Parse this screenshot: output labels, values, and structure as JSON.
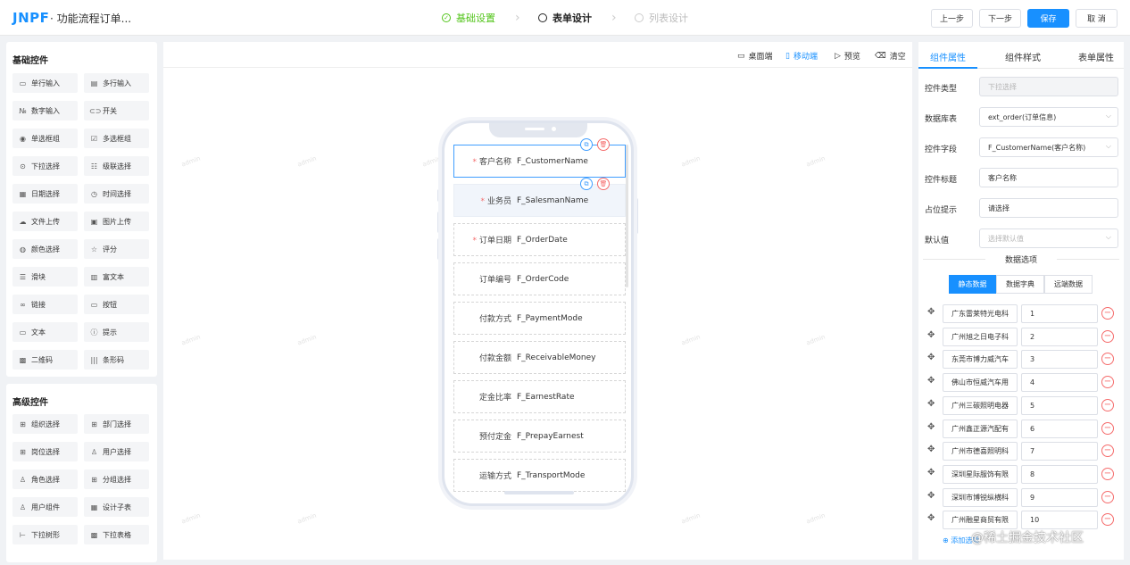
{
  "header": {
    "logo": "JNPF",
    "app_title": "· 功能流程订单...",
    "steps": [
      {
        "label": "基础设置",
        "state": "done"
      },
      {
        "label": "表单设计",
        "state": "active"
      },
      {
        "label": "列表设计",
        "state": "pending"
      }
    ],
    "buttons": {
      "prev": "上一步",
      "next": "下一步",
      "save": "保存",
      "cancel": "取 消"
    }
  },
  "left": {
    "basic_title": "基础控件",
    "basic": [
      {
        "label": "单行输入",
        "icon": "▭"
      },
      {
        "label": "多行输入",
        "icon": "▤"
      },
      {
        "label": "数字输入",
        "icon": "№"
      },
      {
        "label": "开关",
        "icon": "⊂⊃"
      },
      {
        "label": "单选框组",
        "icon": "◉"
      },
      {
        "label": "多选框组",
        "icon": "☑"
      },
      {
        "label": "下拉选择",
        "icon": "⊙"
      },
      {
        "label": "级联选择",
        "icon": "☷"
      },
      {
        "label": "日期选择",
        "icon": "▦"
      },
      {
        "label": "时间选择",
        "icon": "◷"
      },
      {
        "label": "文件上传",
        "icon": "☁"
      },
      {
        "label": "图片上传",
        "icon": "▣"
      },
      {
        "label": "颜色选择",
        "icon": "◍"
      },
      {
        "label": "评分",
        "icon": "☆"
      },
      {
        "label": "滑块",
        "icon": "☰"
      },
      {
        "label": "富文本",
        "icon": "▥"
      },
      {
        "label": "链接",
        "icon": "∞"
      },
      {
        "label": "按钮",
        "icon": "▭"
      },
      {
        "label": "文本",
        "icon": "▭"
      },
      {
        "label": "提示",
        "icon": "ⓘ"
      },
      {
        "label": "二维码",
        "icon": "▩"
      },
      {
        "label": "条形码",
        "icon": "|||"
      }
    ],
    "advanced_title": "高级控件",
    "advanced": [
      {
        "label": "组织选择",
        "icon": "⊞"
      },
      {
        "label": "部门选择",
        "icon": "⊞"
      },
      {
        "label": "岗位选择",
        "icon": "⊞"
      },
      {
        "label": "用户选择",
        "icon": "♙"
      },
      {
        "label": "角色选择",
        "icon": "♙"
      },
      {
        "label": "分组选择",
        "icon": "⊞"
      },
      {
        "label": "用户组件",
        "icon": "♙"
      },
      {
        "label": "设计子表",
        "icon": "▦"
      },
      {
        "label": "下拉树形",
        "icon": "⊢"
      },
      {
        "label": "下拉表格",
        "icon": "▩"
      }
    ]
  },
  "canvas": {
    "toolbar": {
      "desktop": "桌面端",
      "mobile": "移动端",
      "preview": "预览",
      "clear": "清空"
    },
    "watermark": "admin",
    "fields": [
      {
        "label": "客户名称",
        "field": "F_CustomerName",
        "required": "*"
      },
      {
        "label": "业务员",
        "field": "F_SalesmanName",
        "required": "*"
      },
      {
        "label": "订单日期",
        "field": "F_OrderDate",
        "required": "*"
      },
      {
        "label": "订单编号",
        "field": "F_OrderCode",
        "required": ""
      },
      {
        "label": "付款方式",
        "field": "F_PaymentMode",
        "required": ""
      },
      {
        "label": "付款金额",
        "field": "F_ReceivableMoney",
        "required": ""
      },
      {
        "label": "定金比率",
        "field": "F_EarnestRate",
        "required": ""
      },
      {
        "label": "预付定金",
        "field": "F_PrepayEarnest",
        "required": ""
      },
      {
        "label": "运输方式",
        "field": "F_TransportMode",
        "required": ""
      }
    ]
  },
  "right": {
    "tabs": [
      "组件属性",
      "组件样式",
      "表单属性"
    ],
    "props": [
      {
        "label": "控件类型",
        "value": "下拉选择",
        "disabled": true
      },
      {
        "label": "数据库表",
        "value": "ext_order(订单信息)",
        "arrow": "⌵"
      },
      {
        "label": "控件字段",
        "value": "F_CustomerName(客户名称)",
        "arrow": "⌵"
      },
      {
        "label": "控件标题",
        "value": "客户名称"
      },
      {
        "label": "占位提示",
        "value": "请选择"
      },
      {
        "label": "默认值",
        "placeholder": "选择默认值",
        "arrow": "⌵"
      }
    ],
    "options_title": "数据选项",
    "sources": [
      "静态数据",
      "数据字典",
      "远端数据"
    ],
    "options": [
      {
        "label": "广东雷莱特光电科",
        "value": "1"
      },
      {
        "label": "广州旭之日电子科",
        "value": "2"
      },
      {
        "label": "东莞市博力威汽车",
        "value": "3"
      },
      {
        "label": "佛山市恒威汽车用",
        "value": "4"
      },
      {
        "label": "广州三碳照明电器",
        "value": "5"
      },
      {
        "label": "广州鑫正源汽配有",
        "value": "6"
      },
      {
        "label": "广州市德喜照明科",
        "value": "7"
      },
      {
        "label": "深圳星际服饰有限",
        "value": "8"
      },
      {
        "label": "深圳市博锐纵横科",
        "value": "9"
      },
      {
        "label": "广州融星商贸有限",
        "value": "10"
      }
    ],
    "add_option": "添加选项"
  },
  "credit": "@稀土掘金技术社区",
  "colors": {
    "primary": "#1890ff",
    "success": "#52c41a",
    "danger": "#f56c6c"
  }
}
